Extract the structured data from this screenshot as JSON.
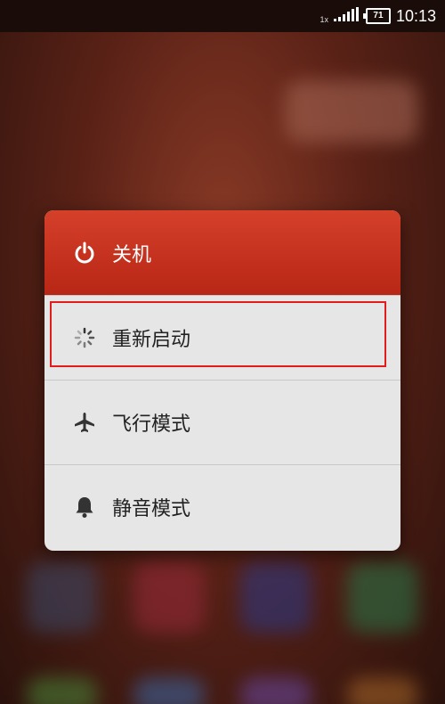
{
  "status_bar": {
    "sim_label": "1x",
    "battery_level": "71",
    "time": "10:13"
  },
  "power_menu": {
    "items": [
      {
        "label": "关机",
        "icon": "power-icon"
      },
      {
        "label": "重新启动",
        "icon": "loading-spinner-icon"
      },
      {
        "label": "飞行模式",
        "icon": "airplane-icon"
      },
      {
        "label": "静音模式",
        "icon": "bell-icon"
      }
    ]
  },
  "colors": {
    "header_red": "#c8321f",
    "highlight_border": "#e21b1b",
    "menu_background": "#e6e6e6"
  }
}
